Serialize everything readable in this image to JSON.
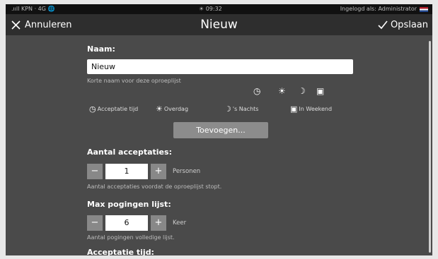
{
  "statusbar": {
    "carrier": ".ııll KPN · 4G",
    "globe_icon": "globe-icon",
    "time": "09:32",
    "time_icon": "sun-icon",
    "login_text": "Ingelogd als: Administrator",
    "flag": "nl-flag-icon"
  },
  "appbar": {
    "cancel_label": "Annuleren",
    "title": "Nieuw",
    "save_label": "Opslaan"
  },
  "form": {
    "name_label": "Naam:",
    "name_value": "Nieuw",
    "name_hint": "Korte naam voor deze oproeplijst",
    "legend": {
      "acceptance": "Acceptatie tijd",
      "day": "Overdag",
      "night": "'s Nachts",
      "weekend": "In Weekend"
    },
    "add_button": "Toevoegen...",
    "count_label": "Aantal acceptaties:",
    "count_value": "1",
    "count_unit": "Personen",
    "count_hint": "Aantal acceptaties voordat de oproeplijst stopt.",
    "max_label": "Max pogingen lijst:",
    "max_value": "6",
    "max_unit": "Keer",
    "max_hint": "Aantal pogingen volledige lijst.",
    "acceptance_time_label": "Acceptatie tijd:"
  },
  "colors": {
    "background": "#4a4a4a",
    "appbar": "#2e2e2e",
    "button": "#8c8c8c"
  }
}
